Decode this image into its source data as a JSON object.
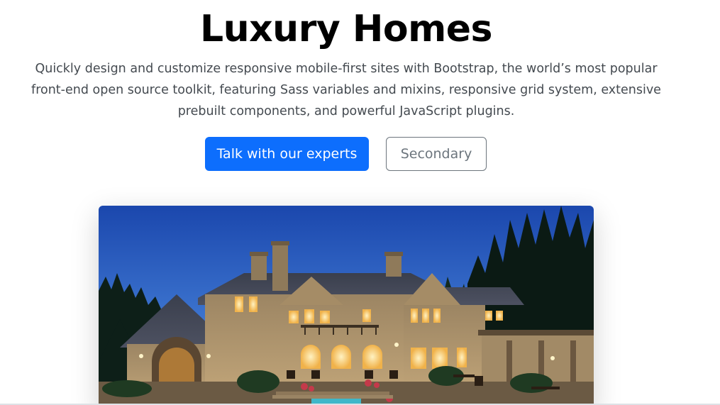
{
  "hero": {
    "title": "Luxury Homes",
    "lead": "Quickly design and customize responsive mobile-first sites with Bootstrap, the world’s most popular front-end open source toolkit, featuring Sass variables and mixins, responsive grid system, extensive prebuilt components, and powerful JavaScript plugins.",
    "primary_button_label": "Talk with our experts",
    "secondary_button_label": "Secondary",
    "image_subject": "luxury-stone-mansion-at-dusk"
  },
  "colors": {
    "primary": "#0d6efd",
    "secondary": "#6c757d",
    "title": "#000000",
    "lead_text": "#444a50",
    "sky_top": "#1f4fb8",
    "sky_bottom": "#4f86d8",
    "stone": "#b8a07a",
    "window_glow": "#ffd27a"
  }
}
